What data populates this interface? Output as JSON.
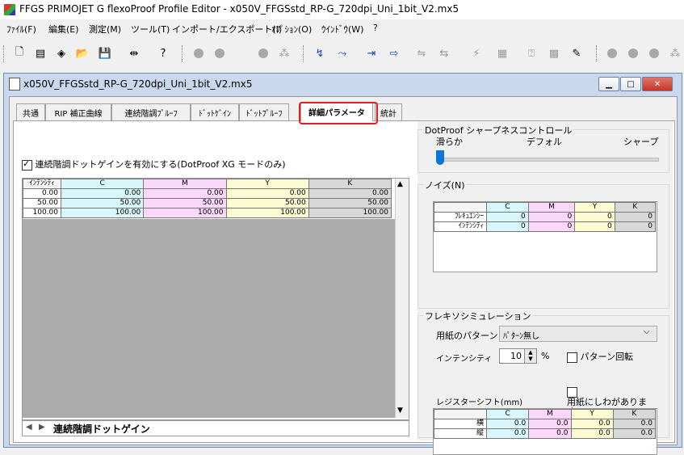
{
  "window": {
    "title": "FFGS PRIMOJET G flexoProof Profile Editor - x050V_FFGSstd_RP-G_720dpi_Uni_1bit_V2.mx5"
  },
  "menu": [
    "ﾌｧｲﾙ(F)",
    "編集(E)",
    "測定(M)",
    "ツール(T)",
    "インポート/エクスポート(I)",
    "ｵﾌﾟｼｮﾝ(O)",
    "ｳｲﾝﾄﾞｳ(W)",
    "?"
  ],
  "document": {
    "title": "x050V_FFGSstd_RP-G_720dpi_Uni_1bit_V2.mx5"
  },
  "tabs": [
    "共通",
    "RIP 補正曲線",
    "連続階調ﾌﾟﾙｰﾌ",
    "ﾄﾞｯﾄｹﾞｲﾝ",
    "ﾄﾞｯﾄﾌﾟﾙｰﾌ",
    "詳細パラメータ",
    "統計"
  ],
  "active_tab": "詳細パラメータ",
  "dotgain": {
    "checkbox_label": "連続階調ドットゲインを有効にする(DotProof XG モードのみ)",
    "checked": true,
    "headers": [
      "ｲﾝﾃﾝｼﾃｨ",
      "C",
      "M",
      "Y",
      "K"
    ],
    "rows": [
      [
        "0.00",
        "0.00",
        "0.00",
        "0.00",
        "0.00"
      ],
      [
        "50.00",
        "50.00",
        "50.00",
        "50.00",
        "50.00"
      ],
      [
        "100.00",
        "100.00",
        "100.00",
        "100.00",
        "100.00"
      ]
    ],
    "sheet_tab": "連続階調ドットゲイン"
  },
  "sharpness": {
    "title": "DotProof シャープネスコントロール",
    "labels": [
      "滑らか",
      "デフォル",
      "シャープ"
    ],
    "level": 0
  },
  "noise": {
    "title": "ノイズ(N)",
    "headers": [
      "",
      "C",
      "M",
      "Y",
      "K"
    ],
    "rows": [
      [
        "ﾌﾚｷｭｴﾝｼｰ",
        "0",
        "0",
        "0",
        "0"
      ],
      [
        "ｲﾝﾃﾝｼﾃｨ",
        "0",
        "0",
        "0",
        "0"
      ]
    ]
  },
  "flexo": {
    "title": "フレキソシミュレーション",
    "paper_pattern_label": "用紙のパターン",
    "paper_pattern_value": "ﾊﾟﾀｰﾝ無し",
    "intensity_label": "インテンシティ",
    "intensity_value": "10",
    "intensity_unit": "%",
    "pattern_rotate_label": "パターン回転",
    "wrinkle_label": "用紙にしわがありま\nす",
    "register_title": "レジスターシフト(mm)",
    "register_headers": [
      "",
      "C",
      "M",
      "Y",
      "K"
    ],
    "register_rows": [
      [
        "横",
        "0.0",
        "0.0",
        "0.0",
        "0.0"
      ],
      [
        "縦",
        "0.0",
        "0.0",
        "0.0",
        "0.0"
      ]
    ]
  },
  "colors": {
    "tab_highlight": "#e02020",
    "C": "#d8f7fb",
    "M": "#fbd8fb",
    "Y": "#fbfbd2",
    "K": "#d8d8d8"
  }
}
